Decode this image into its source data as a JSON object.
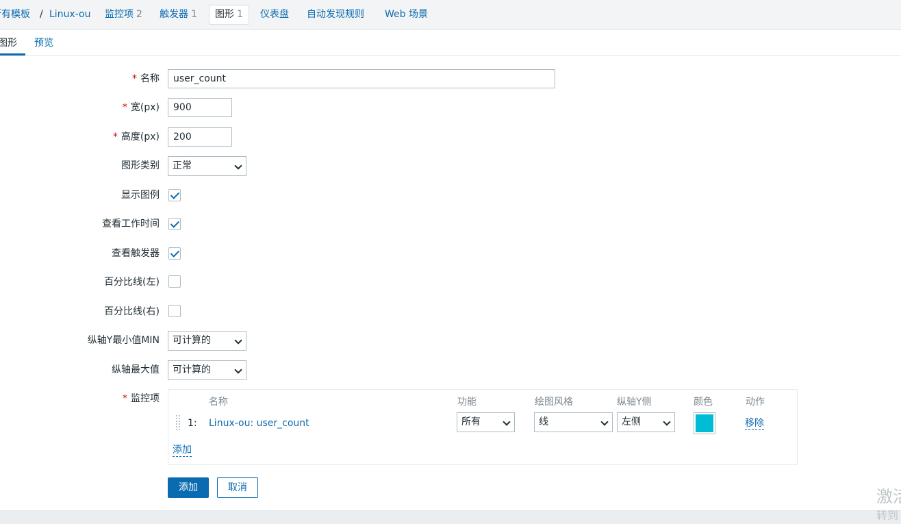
{
  "nav": {
    "breadcrumb_all_templates": "所有模板",
    "breadcrumb_sep": "/",
    "breadcrumb_template": "Linux-ou",
    "items_label": "监控项",
    "items_count": "2",
    "triggers_label": "触发器",
    "triggers_count": "1",
    "graphs_label": "图形",
    "graphs_count": "1",
    "dashboards_label": "仪表盘",
    "discovery_label": "自动发现规则",
    "web_label": "Web 场景"
  },
  "subtabs": {
    "graph": "图形",
    "preview": "预览"
  },
  "form": {
    "name_label": "名称",
    "name_value": "user_count",
    "width_label": "宽(px)",
    "width_value": "900",
    "height_label": "高度(px)",
    "height_value": "200",
    "graph_type_label": "图形类别",
    "graph_type_value": "正常",
    "show_legend_label": "显示图例",
    "show_legend_checked": true,
    "show_work_period_label": "查看工作时间",
    "show_work_period_checked": true,
    "show_triggers_label": "查看触发器",
    "show_triggers_checked": true,
    "percentile_left_label": "百分比线(左)",
    "percentile_left_checked": false,
    "percentile_right_label": "百分比线(右)",
    "percentile_right_checked": false,
    "ymin_label": "纵轴Y最小值MIN",
    "ymin_value": "可计算的",
    "ymax_label": "纵轴最大值",
    "ymax_value": "可计算的",
    "items_label": "监控项"
  },
  "items_table": {
    "headers": {
      "name": "名称",
      "function": "功能",
      "draw_style": "绘图风格",
      "y_axis_side": "纵轴Y侧",
      "color": "颜色",
      "action": "动作"
    },
    "rows": [
      {
        "num": "1:",
        "name": "Linux-ou: user_count",
        "function": "所有",
        "draw_style": "线",
        "y_axis_side": "左侧",
        "color": "#00bcd4",
        "action": "移除"
      }
    ],
    "add_link": "添加"
  },
  "buttons": {
    "add": "添加",
    "cancel": "取消"
  },
  "watermark": {
    "line1": "激活",
    "line2": "转到"
  },
  "colors": {
    "link": "#0b6bb0",
    "required": "#d40000",
    "header_bg": "#f3f4f5"
  }
}
